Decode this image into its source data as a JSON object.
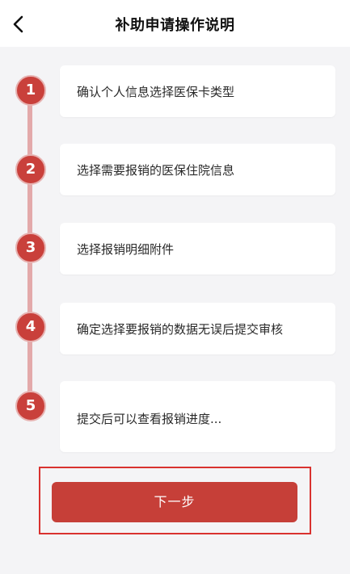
{
  "header": {
    "title": "补助申请操作说明"
  },
  "steps": [
    {
      "number": "1",
      "text": "确认个人信息选择医保卡类型"
    },
    {
      "number": "2",
      "text": "选择需要报销的医保住院信息"
    },
    {
      "number": "3",
      "text": "选择报销明细附件"
    },
    {
      "number": "4",
      "text": "确定选择要报销的数据无误后提交审核"
    },
    {
      "number": "5",
      "text": "提交后可以查看报销进度..."
    }
  ],
  "footer": {
    "next_label": "下一步"
  },
  "colors": {
    "accent": "#c9403b",
    "timeline": "#e3a9aa",
    "highlight": "#d9322f"
  }
}
